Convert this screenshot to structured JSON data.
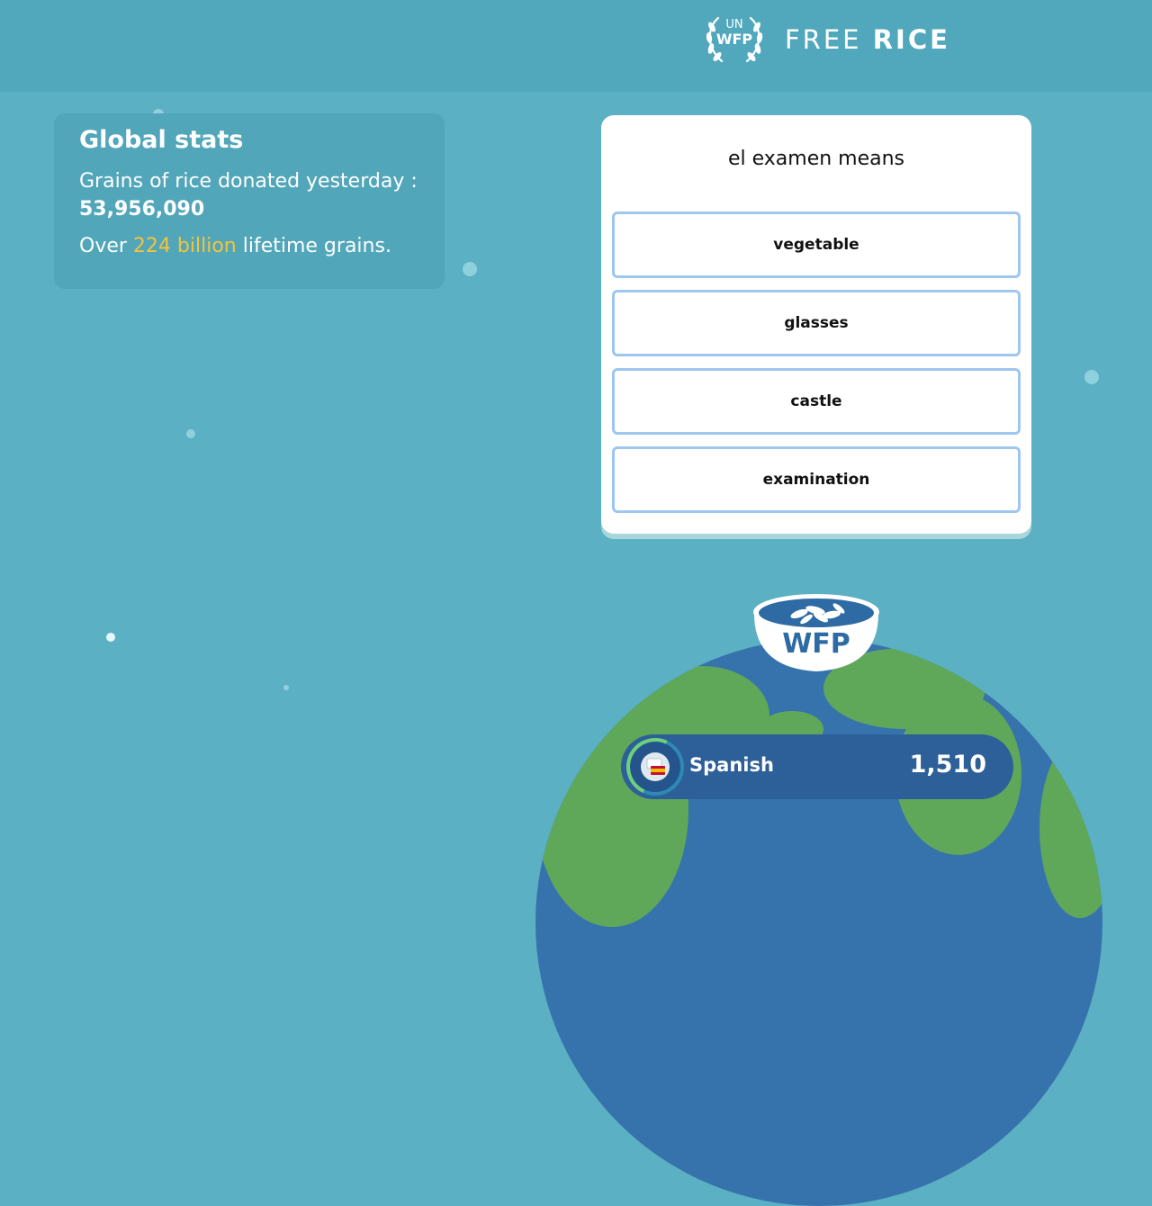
{
  "header": {
    "emblem_un": "UN",
    "emblem_wfp": "WFP",
    "brand_free": "FREE",
    "brand_rice": "RICE"
  },
  "stats": {
    "title": "Global stats",
    "yesterday_label": "Grains of rice donated yesterday :",
    "yesterday_value": "53,956,090",
    "lifetime_prefix": "Over",
    "lifetime_value": "224 billion",
    "lifetime_suffix": "lifetime grains."
  },
  "quiz": {
    "question": "el examen means",
    "answers": [
      "vegetable",
      "glasses",
      "castle",
      "examination"
    ]
  },
  "bowl": {
    "label": "WFP"
  },
  "language": {
    "name": "Spanish",
    "score": "1,510"
  },
  "colors": {
    "background": "#5bb0c3",
    "header": "#51a8bd",
    "highlight": "#f4c33b",
    "answer_border": "#9ec6ef",
    "globe_ocean": "#3673ad",
    "globe_land": "#5fa85a",
    "language_bar": "#2d5f99"
  }
}
